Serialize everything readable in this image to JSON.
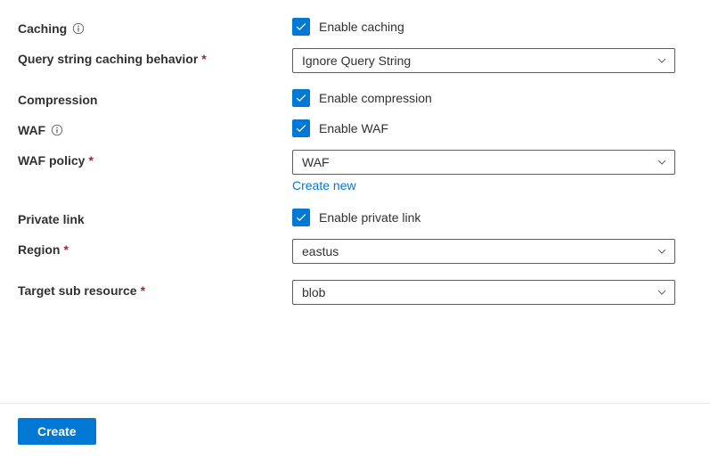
{
  "fields": {
    "caching": {
      "label": "Caching",
      "checkbox_label": "Enable caching"
    },
    "query_string": {
      "label": "Query string caching behavior",
      "value": "Ignore Query String"
    },
    "compression": {
      "label": "Compression",
      "checkbox_label": "Enable compression"
    },
    "waf": {
      "label": "WAF",
      "checkbox_label": "Enable WAF"
    },
    "waf_policy": {
      "label": "WAF policy",
      "value": "WAF",
      "create_new": "Create new"
    },
    "private_link": {
      "label": "Private link",
      "checkbox_label": "Enable private link"
    },
    "region": {
      "label": "Region",
      "value": "eastus"
    },
    "target_sub": {
      "label": "Target sub resource",
      "value": "blob"
    }
  },
  "footer": {
    "create": "Create"
  }
}
